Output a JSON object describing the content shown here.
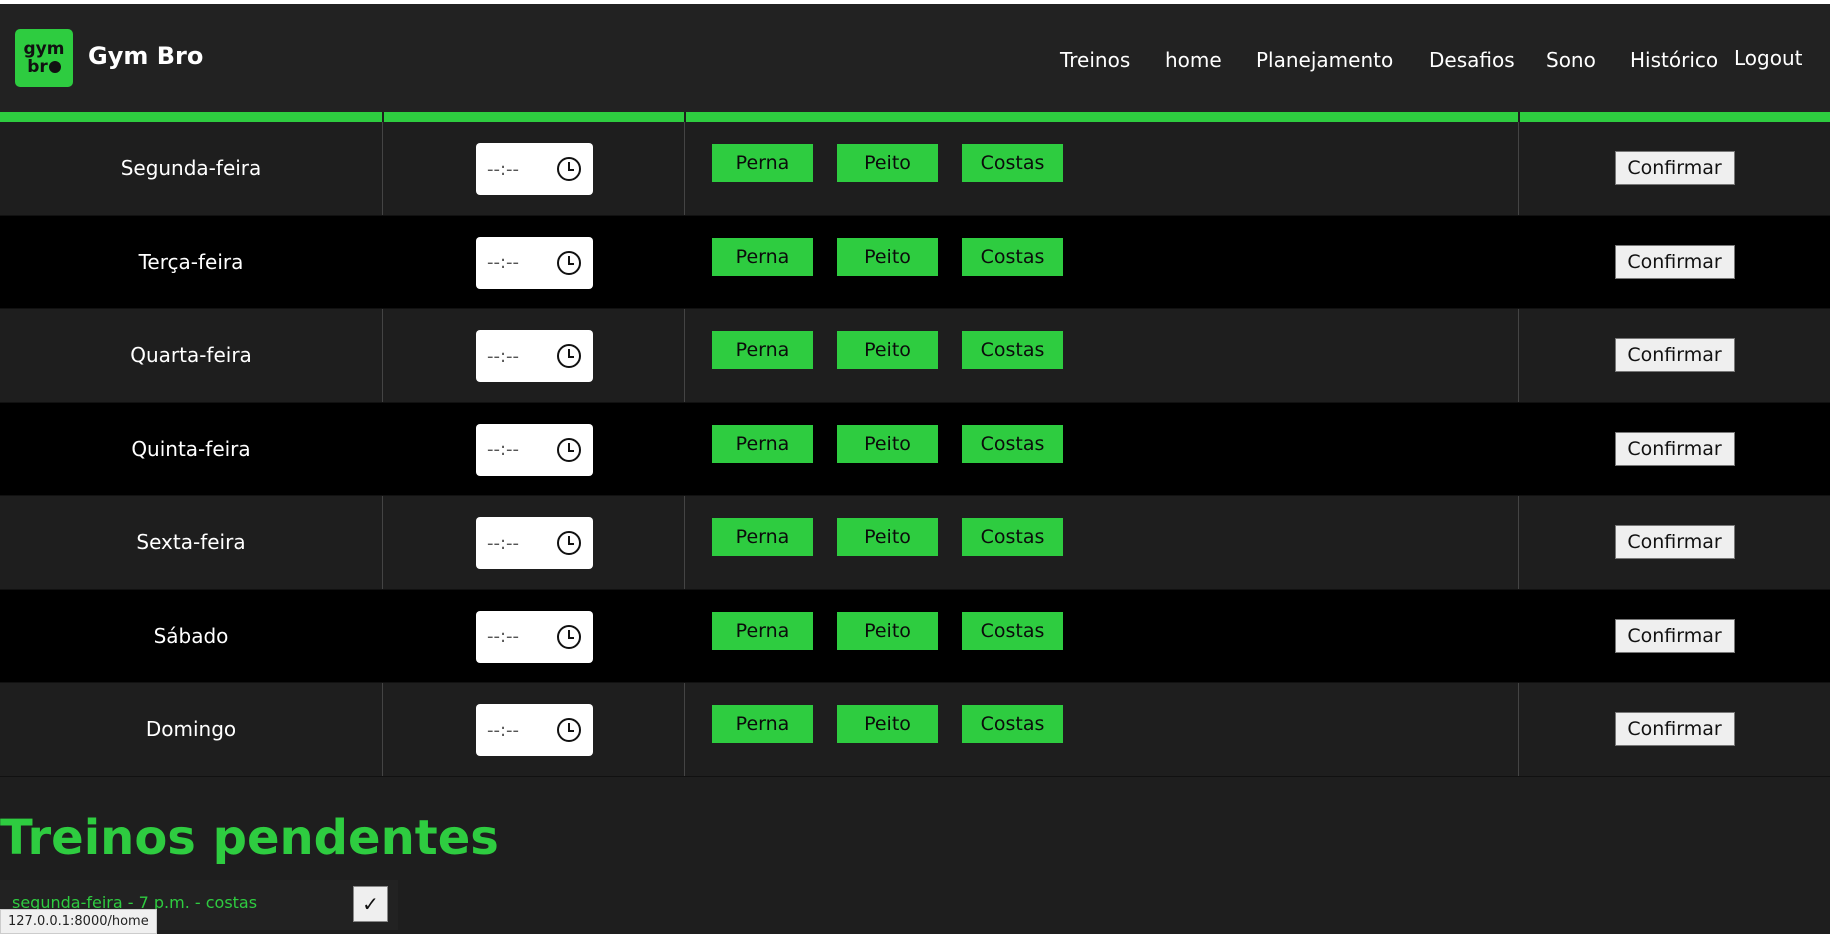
{
  "app": {
    "logo_text_top": "gym",
    "logo_text_bottom": "br",
    "logo_icon": "kettlebell-icon",
    "brand": "Gym Bro"
  },
  "nav": {
    "items": [
      "Treinos",
      "home",
      "Planejamento",
      "Desafios",
      "Sono",
      "Histórico",
      "Logout"
    ]
  },
  "schedule": {
    "time_placeholder": "--:--",
    "clock_icon": "clock-icon",
    "tags": [
      "Perna",
      "Peito",
      "Costas"
    ],
    "confirm_label": "Confirmar",
    "days": [
      "Segunda-feira",
      "Terça-feira",
      "Quarta-feira",
      "Quinta-feira",
      "Sexta-feira",
      "Sábado",
      "Domingo"
    ]
  },
  "pending": {
    "title": "Treinos pendentes",
    "items": [
      {
        "text": "segunda-feira - 7 p.m. - costas",
        "check_label": "✓"
      }
    ]
  },
  "status_bar": {
    "url": "127.0.0.1:8000/home"
  },
  "colors": {
    "accent": "#2ecc40",
    "background": "#1e1e1e",
    "row_alt": "#000000"
  }
}
